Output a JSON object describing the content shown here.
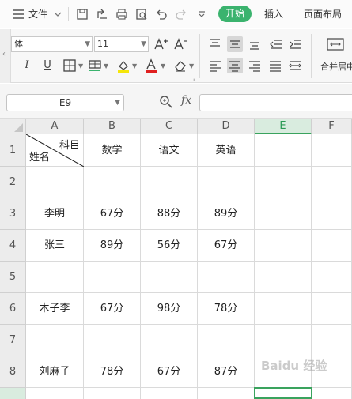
{
  "menubar": {
    "file_label": "文件",
    "tabs": [
      {
        "label": "开始",
        "active": true
      },
      {
        "label": "插入",
        "active": false
      },
      {
        "label": "页面布局",
        "active": false
      }
    ],
    "icons": [
      "hamburger-icon",
      "chevron-down-icon",
      "save-icon",
      "export-icon",
      "print-icon",
      "print-preview-icon",
      "undo-icon",
      "redo-icon",
      "more-icon"
    ],
    "accent_color": "#3bb36e"
  },
  "ribbon": {
    "font_name": "体",
    "font_size": "11",
    "merge_label": "合并居中"
  },
  "formula_bar": {
    "cell_ref": "E9",
    "fx_label": "fx",
    "formula_value": ""
  },
  "grid": {
    "columns": [
      "A",
      "B",
      "C",
      "D",
      "E",
      "F"
    ],
    "rows": [
      "1",
      "2",
      "3",
      "4",
      "5",
      "6",
      "7",
      "8"
    ],
    "header_cell": {
      "top_text": "科目",
      "bottom_text": "姓名"
    },
    "headers": [
      "数学",
      "语文",
      "英语"
    ],
    "data": [
      [
        "",
        "",
        "",
        ""
      ],
      [
        "李明",
        "67分",
        "88分",
        "89分"
      ],
      [
        "张三",
        "89分",
        "56分",
        "67分"
      ],
      [
        "",
        "",
        "",
        ""
      ],
      [
        "木子李",
        "67分",
        "98分",
        "78分"
      ],
      [
        "",
        "",
        "",
        ""
      ],
      [
        "刘麻子",
        "78分",
        "67分",
        "87分"
      ]
    ],
    "selected_cell": "E9",
    "selection_color": "#3aa35e"
  },
  "watermark": "Baidu 经验"
}
